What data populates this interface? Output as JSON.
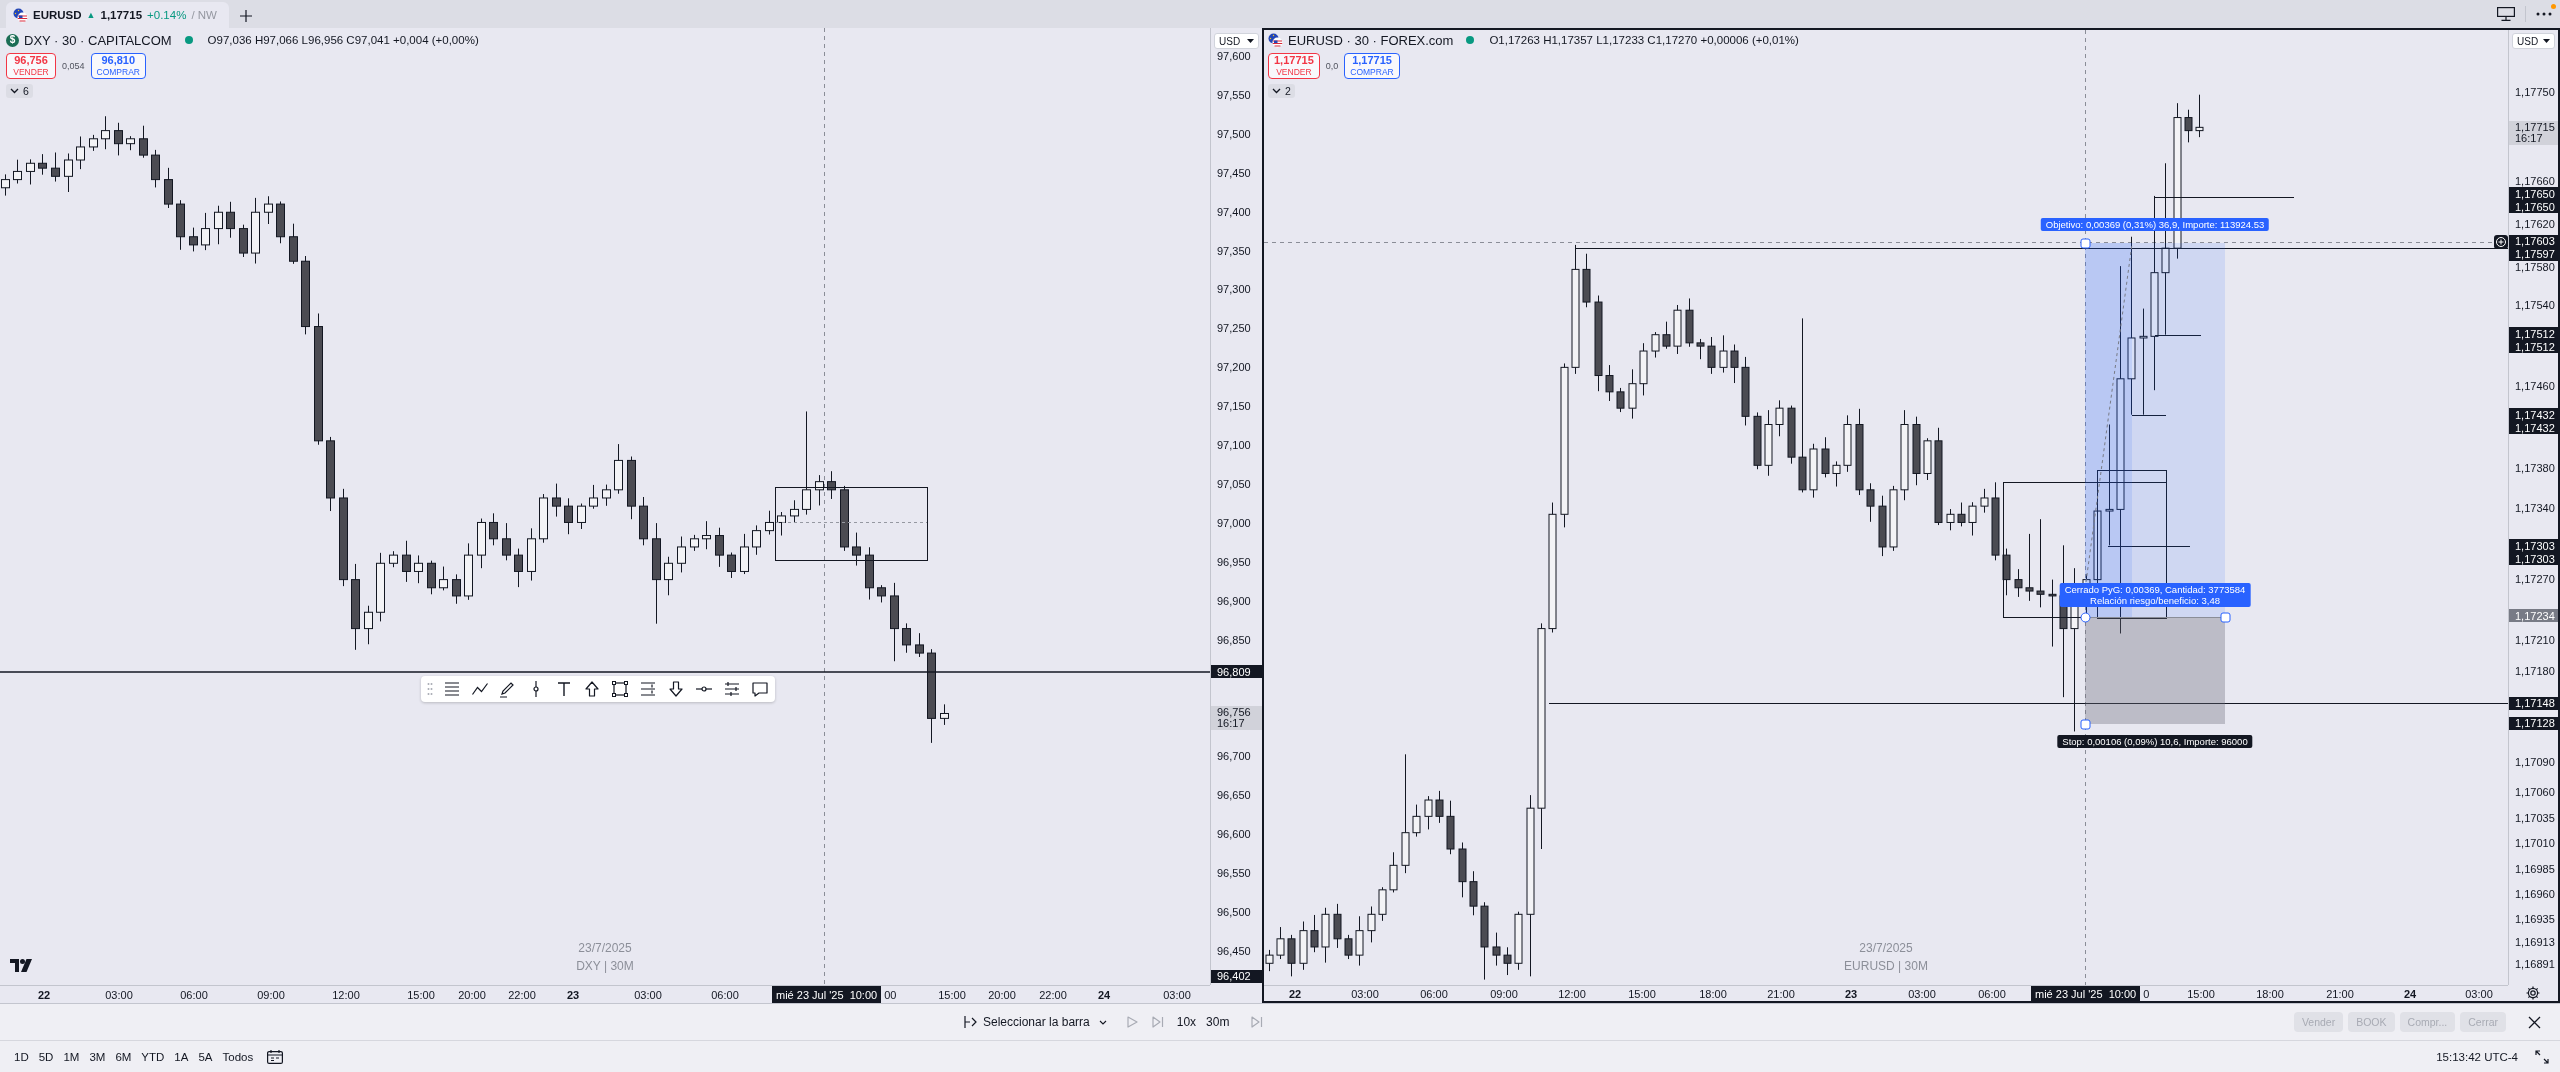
{
  "tab_bar": {
    "tabs": [
      {
        "symbol": "EURUSD",
        "arrow": "▲",
        "price": "1,17715",
        "change": "+0.14%",
        "extra": "/ NW",
        "selected": true
      }
    ],
    "notification": true
  },
  "charts": [
    {
      "selected": false,
      "symbol_icon": "$",
      "title": "DXY · 30 · CAPITALCOM",
      "market_open": true,
      "ohlc": "O97,036 H97,066 L96,956 C97,041 +0,004 (+0,00%)",
      "sell": {
        "price": "96,756",
        "label": "VENDER"
      },
      "spread": "0,054",
      "buy": {
        "price": "96,810",
        "label": "COMPRAR"
      },
      "indicators": "6",
      "currency": "USD",
      "price_axis": [
        {
          "label": "97,600",
          "kind": "tick"
        },
        {
          "label": "97,550",
          "kind": "tick"
        },
        {
          "label": "97,500",
          "kind": "tick"
        },
        {
          "label": "97,450",
          "kind": "tick"
        },
        {
          "label": "97,400",
          "kind": "tick"
        },
        {
          "label": "97,350",
          "kind": "tick"
        },
        {
          "label": "97,300",
          "kind": "tick"
        },
        {
          "label": "97,250",
          "kind": "tick"
        },
        {
          "label": "97,200",
          "kind": "tick"
        },
        {
          "label": "97,150",
          "kind": "tick"
        },
        {
          "label": "97,100",
          "kind": "tick"
        },
        {
          "label": "97,050",
          "kind": "tick"
        },
        {
          "label": "97,000",
          "kind": "tick"
        },
        {
          "label": "96,950",
          "kind": "tick"
        },
        {
          "label": "96,900",
          "kind": "tick"
        },
        {
          "label": "96,850",
          "kind": "tick"
        },
        {
          "label": "96,809",
          "kind": "line"
        },
        {
          "label": "96,756",
          "kind": "last",
          "countdown": "16:17"
        },
        {
          "label": "96,700",
          "kind": "tick"
        },
        {
          "label": "96,650",
          "kind": "tick"
        },
        {
          "label": "96,600",
          "kind": "tick"
        },
        {
          "label": "96,550",
          "kind": "tick"
        },
        {
          "label": "96,500",
          "kind": "tick"
        },
        {
          "label": "96,450",
          "kind": "tick"
        },
        {
          "label": "96,402",
          "kind": "line"
        }
      ],
      "time_axis": [
        {
          "label": "22",
          "kind": "day"
        },
        {
          "label": "03:00",
          "kind": "time"
        },
        {
          "label": "06:00",
          "kind": "time"
        },
        {
          "label": "09:00",
          "kind": "time"
        },
        {
          "label": "12:00",
          "kind": "time"
        },
        {
          "label": "15:00",
          "kind": "time"
        },
        {
          "label": "20:00",
          "kind": "time"
        },
        {
          "label": "22:00",
          "kind": "time"
        },
        {
          "label": "23",
          "kind": "day"
        },
        {
          "label": "03:00",
          "kind": "time"
        },
        {
          "label": "06:00",
          "kind": "time"
        },
        {
          "label": "00",
          "kind": "fragment"
        },
        {
          "label": "15:00",
          "kind": "time"
        },
        {
          "label": "20:00",
          "kind": "time"
        },
        {
          "label": "22:00",
          "kind": "time"
        },
        {
          "label": "24",
          "kind": "day"
        },
        {
          "label": "03:00",
          "kind": "time"
        }
      ],
      "crosshair_time": "mié 23 Jul '25  10:00",
      "watermark": {
        "date": "23/7/2025",
        "symbol": "DXY | 30M"
      }
    },
    {
      "selected": true,
      "title": "EURUSD · 30 · FOREX.com",
      "market_open": true,
      "ohlc": "O1,17263 H1,17357 L1,17233 C1,17270 +0,00006 (+0,01%)",
      "sell": {
        "price": "1,17715",
        "label": "VENDER"
      },
      "spread": "0,0",
      "buy": {
        "price": "1,17715",
        "label": "COMPRAR"
      },
      "indicators": "2",
      "currency": "USD",
      "price_axis": [
        {
          "label": "1,17750",
          "kind": "tick"
        },
        {
          "label": "1,17715",
          "kind": "last",
          "countdown": "16:17"
        },
        {
          "label": "1,17660",
          "kind": "tick"
        },
        {
          "label": "1,17650",
          "kind": "line"
        },
        {
          "label": "1,17650",
          "kind": "line"
        },
        {
          "label": "1,17620",
          "kind": "tick"
        },
        {
          "label": "1,17603",
          "kind": "line"
        },
        {
          "label": "1,17597",
          "kind": "line"
        },
        {
          "label": "1,17580",
          "kind": "tick"
        },
        {
          "label": "1,17540",
          "kind": "tick"
        },
        {
          "label": "1,17512",
          "kind": "line"
        },
        {
          "label": "1,17512",
          "kind": "line"
        },
        {
          "label": "1,17460",
          "kind": "tick"
        },
        {
          "label": "1,17432",
          "kind": "line"
        },
        {
          "label": "1,17432",
          "kind": "line"
        },
        {
          "label": "1,17380",
          "kind": "tick"
        },
        {
          "label": "1,17340",
          "kind": "tick"
        },
        {
          "label": "1,17303",
          "kind": "line"
        },
        {
          "label": "1,17303",
          "kind": "line"
        },
        {
          "label": "1,17270",
          "kind": "tick"
        },
        {
          "label": "1,17234",
          "kind": "position"
        },
        {
          "label": "1,17210",
          "kind": "tick"
        },
        {
          "label": "1,17180",
          "kind": "tick"
        },
        {
          "label": "1,17148",
          "kind": "line"
        },
        {
          "label": "1,17128",
          "kind": "line"
        },
        {
          "label": "1,17090",
          "kind": "tick"
        },
        {
          "label": "1,17060",
          "kind": "tick"
        },
        {
          "label": "1,17035",
          "kind": "tick"
        },
        {
          "label": "1,17010",
          "kind": "tick"
        },
        {
          "label": "1,16985",
          "kind": "tick"
        },
        {
          "label": "1,16960",
          "kind": "tick"
        },
        {
          "label": "1,16935",
          "kind": "tick"
        },
        {
          "label": "1,16913",
          "kind": "tick"
        },
        {
          "label": "1,16891",
          "kind": "tick"
        }
      ],
      "time_axis": [
        {
          "label": "22",
          "kind": "day"
        },
        {
          "label": "03:00",
          "kind": "time"
        },
        {
          "label": "06:00",
          "kind": "time"
        },
        {
          "label": "09:00",
          "kind": "time"
        },
        {
          "label": "12:00",
          "kind": "time"
        },
        {
          "label": "15:00",
          "kind": "time"
        },
        {
          "label": "18:00",
          "kind": "time"
        },
        {
          "label": "21:00",
          "kind": "time"
        },
        {
          "label": "23",
          "kind": "day"
        },
        {
          "label": "03:00",
          "kind": "time"
        },
        {
          "label": "06:00",
          "kind": "time"
        },
        {
          "label": "0",
          "kind": "fragment"
        },
        {
          "label": "15:00",
          "kind": "time"
        },
        {
          "label": "18:00",
          "kind": "time"
        },
        {
          "label": "21:00",
          "kind": "time"
        },
        {
          "label": "24",
          "kind": "day"
        },
        {
          "label": "03:00",
          "kind": "time"
        }
      ],
      "crosshair_time": "mié 23 Jul '25  10:00",
      "watermark": {
        "date": "23/7/2025",
        "symbol": "EURUSD | 30M"
      },
      "position_tool": {
        "target": "Objetivo: 0,00369 (0,31%) 36,9, Importe: 113924.53",
        "result": [
          "Cerrado PyG: 0,00369, Cantidad: 3773584",
          "Relación riesgo/beneficio: 3,48"
        ],
        "stop": "Stop: 0,00106 (0,09%) 10,6, Importe: 96000"
      }
    }
  ],
  "replay_bar": {
    "select_bar": "Seleccionar la barra",
    "speed": "10x",
    "interval": "30m",
    "buttons": [
      {
        "label": "Vender",
        "disabled": true
      },
      {
        "label": "BOOK",
        "disabled": true
      },
      {
        "label": "Compr...",
        "disabled": true
      },
      {
        "label": "Cerrar",
        "disabled": true
      }
    ]
  },
  "range_bar": {
    "ranges": [
      "1D",
      "5D",
      "1M",
      "3M",
      "6M",
      "YTD",
      "1A",
      "5A",
      "Todos"
    ],
    "clock": "15:13:42 UTC-4"
  }
}
